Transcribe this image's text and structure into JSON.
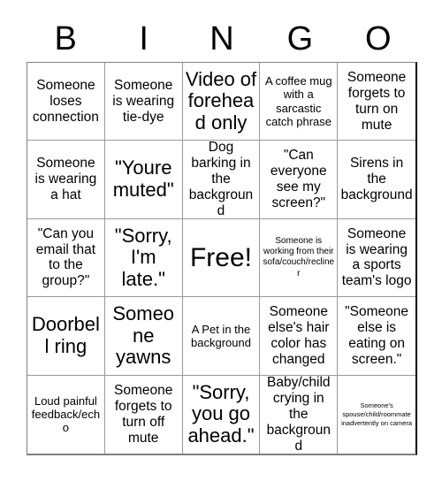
{
  "header": {
    "letters": [
      "B",
      "I",
      "N",
      "G",
      "O"
    ]
  },
  "grid": {
    "rows": 5,
    "columns": 5,
    "cells": [
      {
        "text": "Someone loses connection",
        "size": "sz-md"
      },
      {
        "text": "Someone is wearing tie-dye",
        "size": "sz-md"
      },
      {
        "text": "Video of forehead only",
        "size": "sz-lg"
      },
      {
        "text": "A coffee mug with a sarcastic catch phrase",
        "size": "sz-sm"
      },
      {
        "text": "Someone forgets to turn on mute",
        "size": "sz-md"
      },
      {
        "text": "Someone is wearing a hat",
        "size": "sz-md"
      },
      {
        "text": "\"Youre muted\"",
        "size": "sz-lg"
      },
      {
        "text": "Dog barking in the background",
        "size": "sz-md"
      },
      {
        "text": "\"Can everyone see my screen?\"",
        "size": "sz-md"
      },
      {
        "text": "Sirens in the background",
        "size": "sz-md"
      },
      {
        "text": "\"Can you email that to the group?\"",
        "size": "sz-md"
      },
      {
        "text": "\"Sorry, I'm late.\"",
        "size": "sz-lg"
      },
      {
        "text": "Free!",
        "size": "sz-xl"
      },
      {
        "text": "Someone is working from their sofa/couch/recliner",
        "size": "sz-xs"
      },
      {
        "text": "Someone is wearing a sports team's logo",
        "size": "sz-md"
      },
      {
        "text": "Doorbell ring",
        "size": "sz-lg"
      },
      {
        "text": "Someone yawns",
        "size": "sz-lg"
      },
      {
        "text": "A Pet in the background",
        "size": "sz-sm"
      },
      {
        "text": "Someone else's hair color has changed",
        "size": "sz-md"
      },
      {
        "text": "\"Someone else is eating on screen.\"",
        "size": "sz-md"
      },
      {
        "text": "Loud painful feedback/echo",
        "size": "sz-sm"
      },
      {
        "text": "Someone forgets to turn off mute",
        "size": "sz-md"
      },
      {
        "text": "\"Sorry, you go ahead.\"",
        "size": "sz-lg"
      },
      {
        "text": "Baby/child crying in the background",
        "size": "sz-md"
      },
      {
        "text": "Someone's spouse/child/roommate inadvertently on camera",
        "size": "sz-xxs"
      }
    ]
  }
}
